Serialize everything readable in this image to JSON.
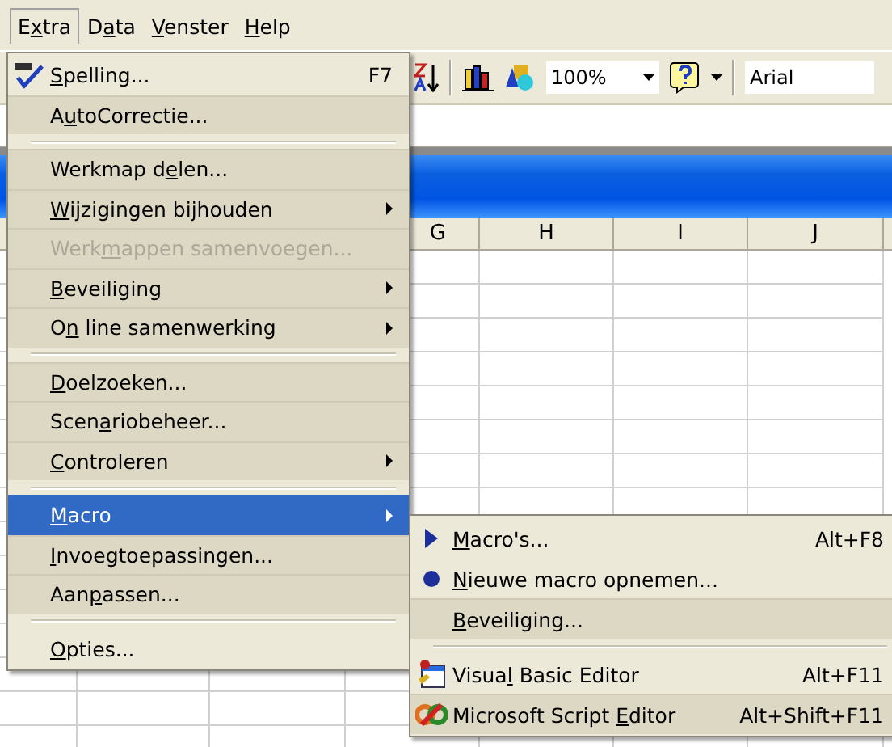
{
  "menu_bar": [
    {
      "label": "Extra",
      "selected": true
    },
    {
      "label": "Data",
      "selected": false
    },
    {
      "label": "Venster",
      "selected": false
    },
    {
      "label": "Help",
      "selected": false
    }
  ],
  "toolbar": {
    "zoom": "100%",
    "font": "Arial"
  },
  "column_headers": [
    "G",
    "H",
    "I",
    "J"
  ],
  "extra_menu": [
    {
      "kind": "item",
      "label": "Spelling...",
      "shortcut": "F7",
      "rarely_used": false,
      "disabled": false,
      "submenu": false,
      "selected": false
    },
    {
      "kind": "item",
      "label": "AutoCorrectie...",
      "rarely_used": true,
      "disabled": false,
      "submenu": false,
      "selected": false
    },
    {
      "kind": "separator"
    },
    {
      "kind": "item",
      "label": "Werkmap delen...",
      "rarely_used": true,
      "disabled": false,
      "submenu": false,
      "selected": false
    },
    {
      "kind": "item",
      "label": "Wijzigingen bijhouden",
      "rarely_used": true,
      "disabled": false,
      "submenu": true,
      "selected": false
    },
    {
      "kind": "item",
      "label": "Werkmappen samenvoegen...",
      "rarely_used": true,
      "disabled": true,
      "submenu": false,
      "selected": false
    },
    {
      "kind": "item",
      "label": "Beveiliging",
      "rarely_used": true,
      "disabled": false,
      "submenu": true,
      "selected": false
    },
    {
      "kind": "item",
      "label": "On line samenwerking",
      "rarely_used": true,
      "disabled": false,
      "submenu": true,
      "selected": false
    },
    {
      "kind": "separator"
    },
    {
      "kind": "item",
      "label": "Doelzoeken...",
      "rarely_used": true,
      "disabled": false,
      "submenu": false,
      "selected": false
    },
    {
      "kind": "item",
      "label": "Scenariobeheer...",
      "rarely_used": true,
      "disabled": false,
      "submenu": false,
      "selected": false
    },
    {
      "kind": "item",
      "label": "Controleren",
      "rarely_used": true,
      "disabled": false,
      "submenu": true,
      "selected": false
    },
    {
      "kind": "separator"
    },
    {
      "kind": "item",
      "label": "Macro",
      "rarely_used": true,
      "disabled": false,
      "submenu": true,
      "selected": true
    },
    {
      "kind": "item",
      "label": "Invoegtoepassingen...",
      "rarely_used": true,
      "disabled": false,
      "submenu": false,
      "selected": false
    },
    {
      "kind": "item",
      "label": "Aanpassen...",
      "rarely_used": true,
      "disabled": false,
      "submenu": false,
      "selected": false
    },
    {
      "kind": "separator"
    },
    {
      "kind": "item",
      "label": "Opties...",
      "rarely_used": false,
      "disabled": false,
      "submenu": false,
      "selected": false
    }
  ],
  "macro_submenu": [
    {
      "kind": "item",
      "label": "Macro's...",
      "shortcut": "Alt+F8",
      "rarely_used": false,
      "selected": false
    },
    {
      "kind": "item",
      "label": "Nieuwe macro opnemen...",
      "rarely_used": false,
      "selected": false
    },
    {
      "kind": "item",
      "label": "Beveiliging...",
      "rarely_used": true,
      "selected": false
    },
    {
      "kind": "separator"
    },
    {
      "kind": "item",
      "label": "Visual Basic Editor",
      "shortcut": "Alt+F11",
      "rarely_used": false,
      "selected": false
    },
    {
      "kind": "item",
      "label": "Microsoft Script Editor",
      "shortcut": "Alt+Shift+F11",
      "rarely_used": true,
      "selected": false
    }
  ]
}
